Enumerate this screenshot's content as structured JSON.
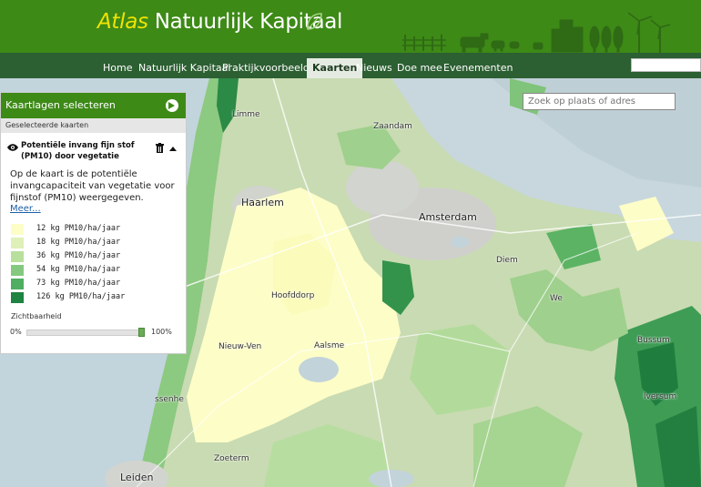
{
  "header": {
    "title_prefix": "Atlas",
    "title_main": "Natuurlijk Kapitaal",
    "brand_color": "#3d8a17",
    "accent_color": "#f1e300"
  },
  "nav": {
    "items": [
      {
        "label": "Home"
      },
      {
        "label": "Natuurlijk Kapitaal"
      },
      {
        "label": "Praktijkvoorbeelden"
      },
      {
        "label": "Kaarten",
        "active": true
      },
      {
        "label": "Nieuws"
      },
      {
        "label": "Doe mee"
      },
      {
        "label": "Evenementen"
      }
    ]
  },
  "map": {
    "search_placeholder": "Zoek op plaats of adres",
    "labels": {
      "zaandam": "Zaandam",
      "haarlem": "Haarlem",
      "amsterdam": "Amsterdam",
      "hoofddorp": "Hoofddorp",
      "diemen": "Diem",
      "aalsmeer": "Aalsme",
      "nieuw_vennep": "Nieuw-Ven",
      "bussum": "Bussum",
      "hilversum": "lversum",
      "leiden": "Leiden",
      "limmen": "Limme",
      "weesp": "We",
      "sassenheim": "ssenhe",
      "lisse": "Lisse",
      "zoetermeer": "Zoeterm"
    }
  },
  "panel": {
    "header": "Kaartlagen selecteren",
    "subheader": "Geselecteerde kaarten",
    "layer_title": "Potentiële invang fijn stof (PM10) door vegetatie",
    "description": "Op de kaart is de potentiële invangcapaciteit van vegetatie voor fijnstof (PM10) weergegeven.",
    "more_link": "Meer...",
    "legend": [
      {
        "label": "12 kg PM10/ha/jaar",
        "color": "#fdfdc8"
      },
      {
        "label": "18 kg PM10/ha/jaar",
        "color": "#dff0b8"
      },
      {
        "label": "36 kg PM10/ha/jaar",
        "color": "#b8e09d"
      },
      {
        "label": "54 kg PM10/ha/jaar",
        "color": "#84c97f"
      },
      {
        "label": "73 kg PM10/ha/jaar",
        "color": "#4fae62"
      },
      {
        "label": "126 kg PM10/ha/jaar",
        "color": "#1d8442"
      }
    ],
    "opacity": {
      "label": "Zichtbaarheid",
      "min_label": "0%",
      "max_label": "100%",
      "value": 1.0
    }
  }
}
